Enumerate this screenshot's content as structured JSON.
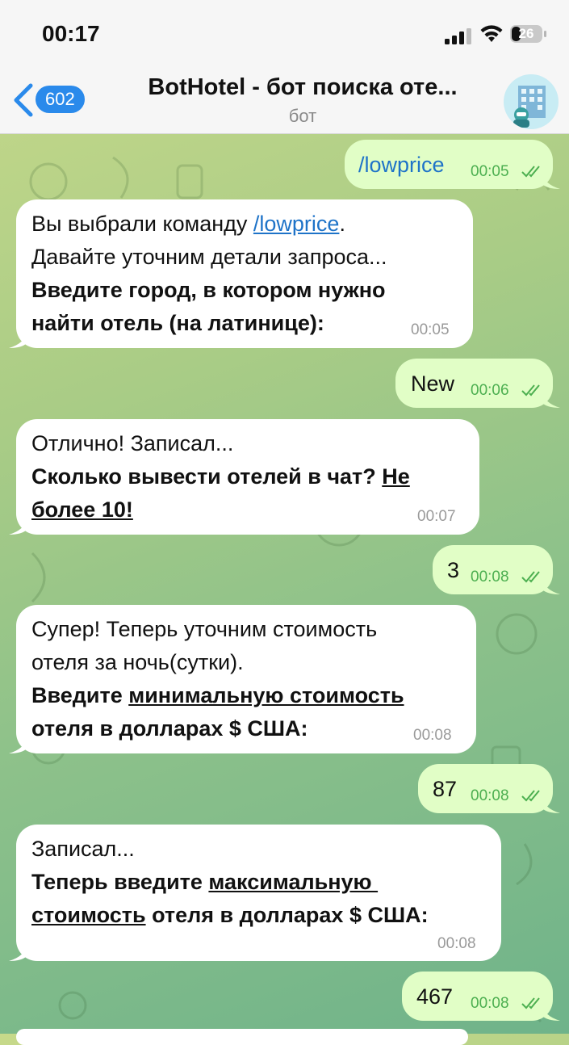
{
  "status_bar": {
    "time": "00:17",
    "battery": "26"
  },
  "header": {
    "back_count": "602",
    "title": "BotHotel - бот поиска оте...",
    "subtitle": "бот"
  },
  "messages": [
    {
      "type": "out",
      "text": "/lowprice",
      "time": "00:05"
    },
    {
      "type": "in",
      "line1_prefix": "Вы выбрали команду ",
      "line1_link": "/lowprice",
      "line1_suffix": ".",
      "line2": "Давайте уточним детали запроса...",
      "line3": "Введите город, в котором нужно",
      "line4": "найти отель (на латинице):",
      "time": "00:05"
    },
    {
      "type": "out",
      "text": "New",
      "time": "00:06"
    },
    {
      "type": "in",
      "line1": "Отлично! Записал...",
      "line2_bold": "Сколько вывести отелей в чат? ",
      "line2_underline": "Не",
      "line3_underline": "более 10!",
      "time": "00:07"
    },
    {
      "type": "out",
      "text": "3",
      "time": "00:08"
    },
    {
      "type": "in",
      "line1": "Супер! Теперь уточним стоимость",
      "line2": "отеля за ночь(сутки).",
      "line3_bold": "Введите ",
      "line3_underline": "минимальную стоимость",
      "line4": "отеля в долларах $ США:",
      "time": "00:08"
    },
    {
      "type": "out",
      "text": "87",
      "time": "00:08"
    },
    {
      "type": "in",
      "line1": "Записал...",
      "line2_bold": "Теперь введите ",
      "line2_underline": "максимальную ",
      "line3_underline": "стоимость",
      "line3_bold": " отеля в долларах $ США:",
      "time": "00:08"
    },
    {
      "type": "out",
      "text": "467",
      "time": "00:08"
    }
  ],
  "colors": {
    "accent": "#2a8aeb",
    "outgoing_bubble": "#e1fec6",
    "incoming_bubble": "#ffffff",
    "read_checks": "#4caf50"
  }
}
